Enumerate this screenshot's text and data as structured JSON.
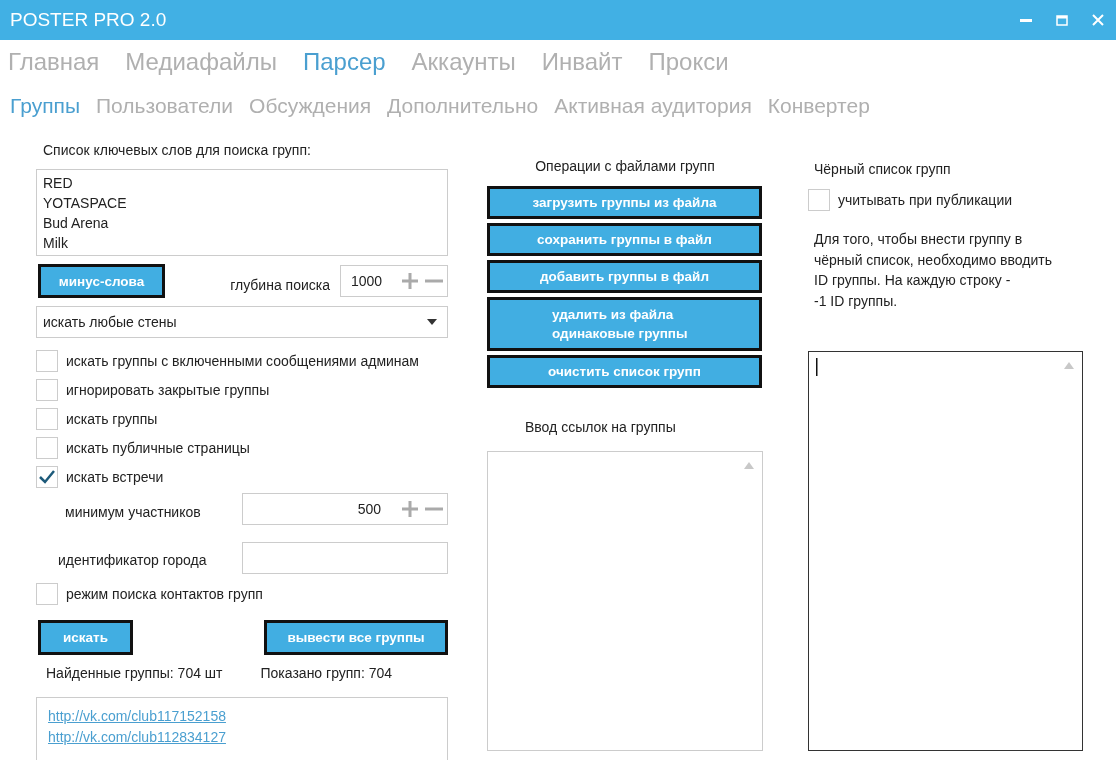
{
  "window": {
    "title": "POSTER PRO 2.0"
  },
  "tabs": [
    {
      "label": "Главная",
      "selected": false
    },
    {
      "label": "Медиафайлы",
      "selected": false
    },
    {
      "label": "Парсер",
      "selected": true
    },
    {
      "label": "Аккаунты",
      "selected": false
    },
    {
      "label": "Инвайт",
      "selected": false
    },
    {
      "label": "Прокси",
      "selected": false
    }
  ],
  "subtabs": [
    {
      "label": "Группы",
      "selected": true
    },
    {
      "label": "Пользователи",
      "selected": false
    },
    {
      "label": "Обсуждения",
      "selected": false
    },
    {
      "label": "Дополнительно",
      "selected": false
    },
    {
      "label": "Активная аудитория",
      "selected": false
    },
    {
      "label": "Конвертер",
      "selected": false
    }
  ],
  "search": {
    "keywords_label": "Список ключевых слов для поиска групп:",
    "keywords": [
      "RED",
      "YOTASPACE",
      "Bud Arena",
      "Milk"
    ],
    "minus_button": "минус-слова",
    "depth_label": "глубина поиска",
    "depth_value": "1000",
    "wall_dropdown": "искать любые стены",
    "options": [
      {
        "label": "искать группы с включенными сообщениями админам",
        "checked": false
      },
      {
        "label": "игнорировать закрытые группы",
        "checked": false
      },
      {
        "label": "искать группы",
        "checked": false
      },
      {
        "label": "искать публичные страницы",
        "checked": false
      },
      {
        "label": "искать встречи",
        "checked": true
      }
    ],
    "min_members_label": "минимум участников",
    "min_members_value": "500",
    "city_label": "идентификатор города",
    "contacts_option": {
      "label": "режим поиска контактов групп",
      "checked": false
    },
    "search_button": "искать",
    "show_all_button": "вывести все группы",
    "found_label": "Найденные группы: 704 шт",
    "shown_label": "Показано групп: 704",
    "results": [
      "http://vk.com/club117152158",
      "http://vk.com/club112834127"
    ]
  },
  "file_ops": {
    "title": "Операции с файлами групп",
    "buttons": [
      "загрузить группы из файла",
      "сохранить группы в файл",
      "добавить группы в файл",
      "удалить из файла\nодинаковые группы",
      "очистить список групп"
    ],
    "links_title": "Ввод ссылок на группы"
  },
  "blacklist": {
    "title": "Чёрный список групп",
    "option": {
      "label": "учитывать при публикации",
      "checked": false
    },
    "hint": "Для того, чтобы внести группу в\nчёрный список, необходимо вводить\nID группы. На каждую строку -\n-1 ID группы."
  }
}
